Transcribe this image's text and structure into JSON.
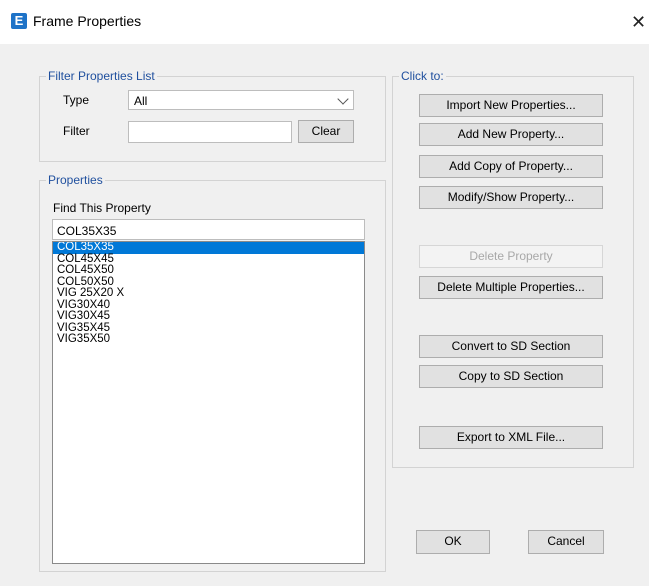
{
  "window": {
    "title": "Frame Properties",
    "app_icon_letter": "E",
    "close_glyph": "✕"
  },
  "filter_group": {
    "legend": "Filter Properties List",
    "type_label": "Type",
    "type_value": "All",
    "filter_label": "Filter",
    "filter_value": "",
    "clear_label": "Clear"
  },
  "properties_group": {
    "legend": "Properties",
    "find_label": "Find This Property",
    "find_value": "COL35X35",
    "items": [
      "COL35X35",
      "COL45X45",
      "COL45X50",
      "COL50X50",
      "VIG 25X20 X",
      "VIG30X40",
      "VIG30X45",
      "VIG35X45",
      "VIG35X50"
    ],
    "selected_index": 0
  },
  "click_group": {
    "legend": "Click to:",
    "buttons": {
      "import": "Import New Properties...",
      "add": "Add New Property...",
      "add_copy": "Add Copy of Property...",
      "modify": "Modify/Show Property...",
      "delete": "Delete Property",
      "delete_multiple": "Delete Multiple Properties...",
      "convert_sd": "Convert to SD Section",
      "copy_sd": "Copy to SD Section",
      "export_xml": "Export to XML File..."
    }
  },
  "footer": {
    "ok": "OK",
    "cancel": "Cancel"
  },
  "colors": {
    "accent": "#0078d7",
    "legend": "#1f4f9e",
    "app_icon": "#1e73c8"
  }
}
